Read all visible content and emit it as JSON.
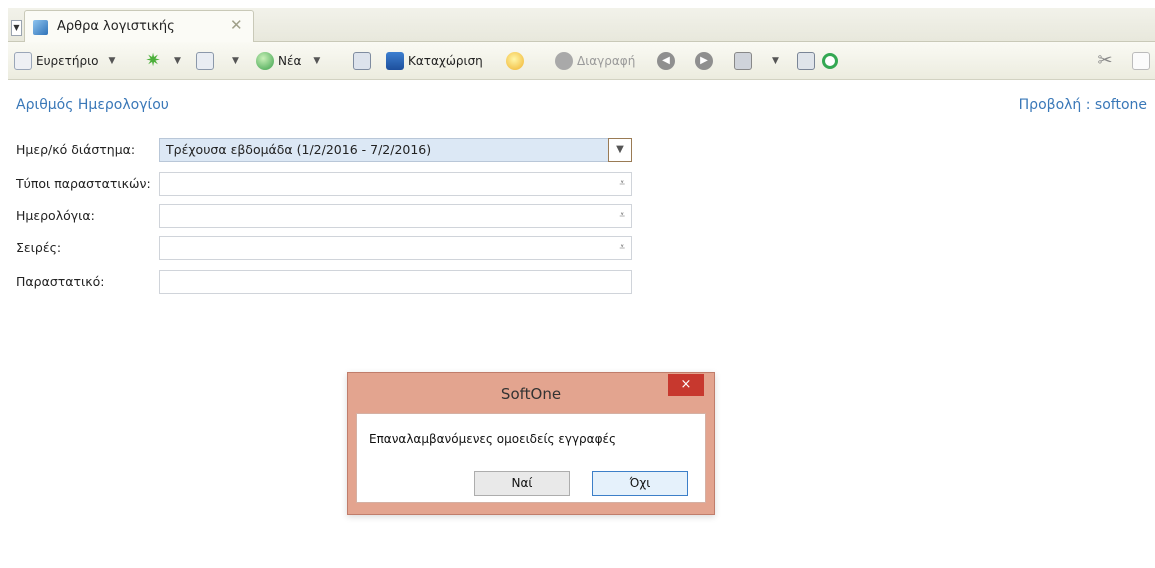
{
  "tab": {
    "title": "Αρθρα λογιστικής"
  },
  "toolbar": {
    "index_label": "Ευρετήριο",
    "new_label": "Νέα",
    "save_label": "Καταχώριση",
    "delete_label": "Διαγραφή"
  },
  "header": {
    "title": "Αριθμός Ημερολογίου",
    "view_label": "Προβολή : softone"
  },
  "form": {
    "rows": [
      {
        "label": "Ημερ/κό διάστημα:",
        "value": "Τρέχουσα εβδομάδα (1/2/2016 - 7/2/2016)"
      },
      {
        "label": "Τύποι παραστατικών:",
        "value": ""
      },
      {
        "label": "Ημερολόγια:",
        "value": ""
      },
      {
        "label": "Σειρές:",
        "value": ""
      },
      {
        "label": "Παραστατικό:",
        "value": ""
      }
    ]
  },
  "dialog": {
    "title": "SoftOne",
    "close_glyph": "×",
    "message": "Επαναλαμβανόμενες ομοειδείς εγγραφές",
    "yes_label": "Ναί",
    "no_label": "Όχι"
  },
  "colors": {
    "accent": "#3a78b8",
    "dialog_frame": "#e3a48f",
    "close_red": "#c7382e"
  }
}
